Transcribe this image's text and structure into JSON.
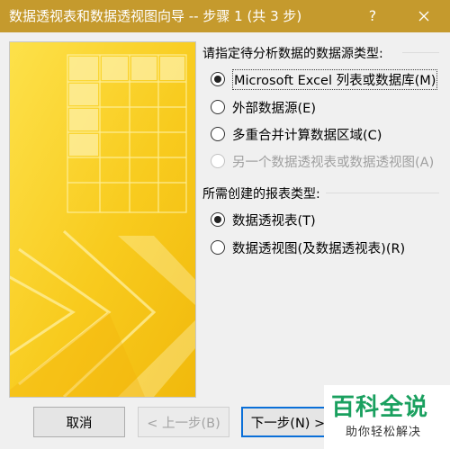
{
  "window": {
    "title": "数据透视表和数据透视图向导 -- 步骤 1 (共 3 步)",
    "help_label": "?"
  },
  "source_section": {
    "heading": "请指定待分析数据的数据源类型:",
    "options": [
      {
        "label": "Microsoft Excel 列表或数据库(M)",
        "checked": true,
        "enabled": true
      },
      {
        "label": "外部数据源(E)",
        "checked": false,
        "enabled": true
      },
      {
        "label": "多重合并计算数据区域(C)",
        "checked": false,
        "enabled": true
      },
      {
        "label": "另一个数据透视表或数据透视图(A)",
        "checked": false,
        "enabled": false
      }
    ]
  },
  "report_section": {
    "heading": "所需创建的报表类型:",
    "options": [
      {
        "label": "数据透视表(T)",
        "checked": true,
        "enabled": true
      },
      {
        "label": "数据透视图(及数据透视表)(R)",
        "checked": false,
        "enabled": true
      }
    ]
  },
  "buttons": {
    "cancel": "取消",
    "back": "< 上一步(B)",
    "next": "下一步(N) >"
  },
  "watermark": {
    "brand": "百科全说",
    "slogan": "助你轻松解决"
  },
  "colors": {
    "titlebar": "#c59a2d",
    "banner_yellow": "#f8cb1e",
    "focus_blue": "#0a6fd8",
    "brand_green": "#1aa05f"
  },
  "icons": [
    "close-icon",
    "help-icon",
    "pivot-wizard-banner"
  ]
}
